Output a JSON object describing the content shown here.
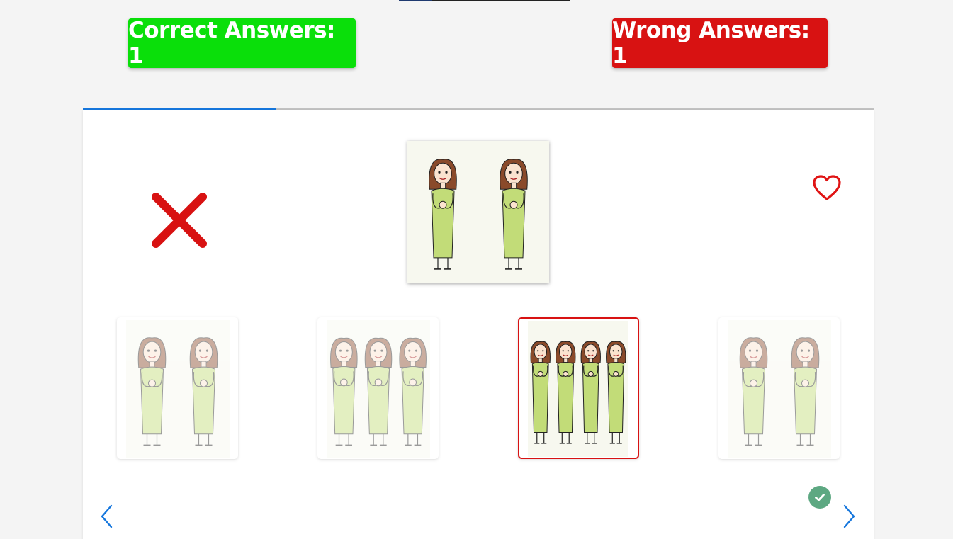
{
  "score": {
    "correct_label": "Correct Answers: 1",
    "wrong_label": "Wrong Answers: 1"
  },
  "progress": {
    "fraction": 0.245
  },
  "colors": {
    "correct": "#0adf0a",
    "wrong": "#d81212",
    "accent": "#1677dd",
    "check": "#5da882"
  },
  "icons": {
    "result": "close-icon",
    "favorite": "heart-outline-icon",
    "checked": "check-circle-icon",
    "prev": "chevron-left-icon",
    "next": "chevron-right-icon"
  },
  "prompt": {
    "figures": 2
  },
  "options": [
    {
      "figures": 2,
      "state": "dim"
    },
    {
      "figures": 3,
      "state": "dim"
    },
    {
      "figures": 4,
      "state": "selected"
    },
    {
      "figures": 2,
      "state": "dim"
    }
  ]
}
